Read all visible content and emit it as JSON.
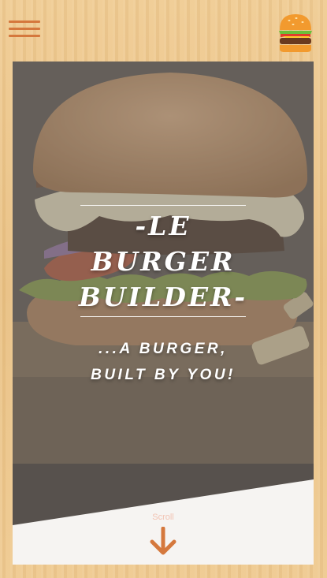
{
  "header": {
    "menu_icon": "hamburger-menu-icon",
    "logo_icon": "burger-logo-icon"
  },
  "hero": {
    "title_line_1": "-LE",
    "title_line_2": "BURGER",
    "title_line_3": "BUILDER-",
    "tagline_line_1": "...A BURGER,",
    "tagline_line_2": "BUILT BY YOU!"
  },
  "scroll": {
    "label": "Scroll",
    "icon": "arrow-down-icon"
  },
  "colors": {
    "accent": "#d5783d",
    "panel_white": "#f6f4f2",
    "wood": "#ecc58a"
  }
}
